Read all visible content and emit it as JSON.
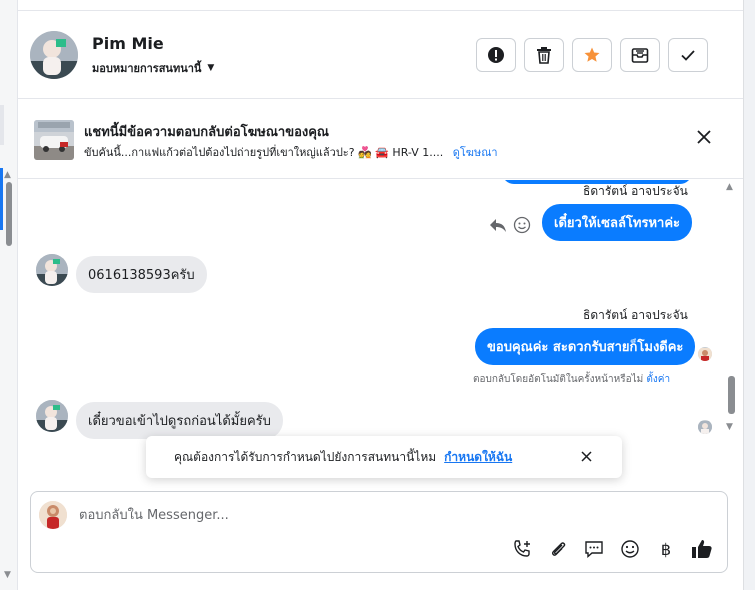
{
  "header": {
    "contact_name": "Pim Mie",
    "assign_label": "มอบหมายการสนทนานี้",
    "actions": [
      "report-icon",
      "trash-icon",
      "star-icon",
      "mark-unread-icon",
      "check-icon"
    ]
  },
  "ad_banner": {
    "title": "แชทนี้มีข้อความตอบกลับต่อโฆษณาของคุณ",
    "subtitle": "ขับคันนี้...กาแฟแก้วต่อไปต้องไปถ่ายรูปที่เขาใหญ่แล้วปะ? 💑 🚘 HR-V 1....",
    "view_ad_link": "ดูโฆษณา"
  },
  "messages": {
    "sender_1": "ธิดารัตน์ อาจประจัน",
    "outgoing_1": "เดี๋ยวให้เซลล์โทรหาค่ะ",
    "incoming_1": "0616138593ครับ",
    "sender_2": "ธิดารัตน์ อาจประจัน",
    "outgoing_2": "ขอบคุณค่ะ สะดวกรับสายก็โมงดีคะ",
    "auto_reply_note": "ตอบกลับโดยอัตโนมัติในครั้งหน้าหรือไม่",
    "auto_reply_setting_link": "ตั้งค่า",
    "incoming_2": "เดี๋ยวขอเข้าไปดูรถก่อนได้มั้ยครับ"
  },
  "toast": {
    "text": "คุณต้องการได้รับการกำหนดไปยังการสนทนานี้ไหม",
    "link": "กำหนดให้ฉัน"
  },
  "composer": {
    "placeholder": "ตอบกลับใน Messenger...",
    "baht_symbol": "฿",
    "tools": [
      "call-add-icon",
      "attach-icon",
      "saved-replies-icon",
      "emoji-icon",
      "baht-icon",
      "like-icon"
    ]
  },
  "colors": {
    "accent": "#0a7cff",
    "link": "#1877f2",
    "incoming_bubble": "#e9eaed",
    "star": "#f7923a"
  }
}
